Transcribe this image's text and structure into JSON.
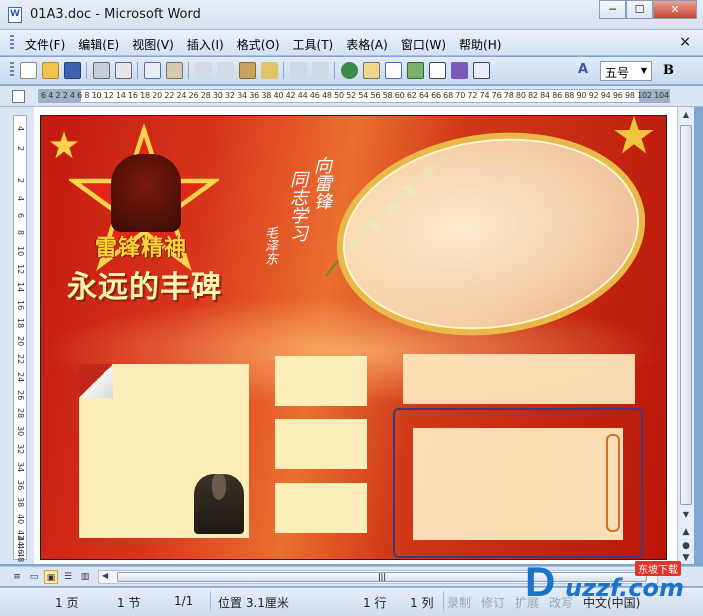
{
  "window": {
    "title": "01A3.doc - Microsoft Word",
    "minimize": "─",
    "maximize": "☐",
    "close": "✕"
  },
  "menubar": {
    "items": [
      "文件(F)",
      "编辑(E)",
      "视图(V)",
      "插入(I)",
      "格式(O)",
      "工具(T)",
      "表格(A)",
      "窗口(W)",
      "帮助(H)"
    ],
    "close": "×"
  },
  "toolbar": {
    "font_size": "五号",
    "bold": "B",
    "font_style_icon": "A"
  },
  "ruler": {
    "text": "6 4 2    2  4  6  8 10 12 14 16 18 20 22 24 26 28 30 32 34 36 38 40 42 44 46 48 50 52 54 56 58 60 62 64 66 68 70 72 74 76 78 80 82 84 86 88 90 92 94 96 98     102 104 106"
  },
  "vruler": {
    "ticks": [
      "4",
      "2",
      "2",
      "4",
      "6",
      "8",
      "10",
      "12",
      "14",
      "16",
      "18",
      "20",
      "22",
      "24",
      "26",
      "28",
      "30",
      "32",
      "34",
      "36",
      "38",
      "40",
      "42",
      "44",
      "46",
      "48"
    ]
  },
  "poster": {
    "title_line1": "雷锋精神",
    "title_line2": "永远的丰碑",
    "calligraphy_1": "向雷锋",
    "calligraphy_2": "同志学习",
    "calligraphy_3": "毛泽东"
  },
  "statusbar": {
    "page": "1 页",
    "section": "1 节",
    "page_of": "1/1",
    "position": "位置 3.1厘米",
    "line": "1 行",
    "column": "1 列",
    "record": "录制",
    "revise": "修订",
    "extend": "扩展",
    "overtype": "改写",
    "language": "中文(中国)"
  },
  "watermark": {
    "brand": "uzzf.com",
    "tag": "东坡下载"
  },
  "colors": {
    "poster_red": "#c21a10",
    "panel_cream": "#fdeeb9",
    "title_gold": "#ffd23a"
  }
}
